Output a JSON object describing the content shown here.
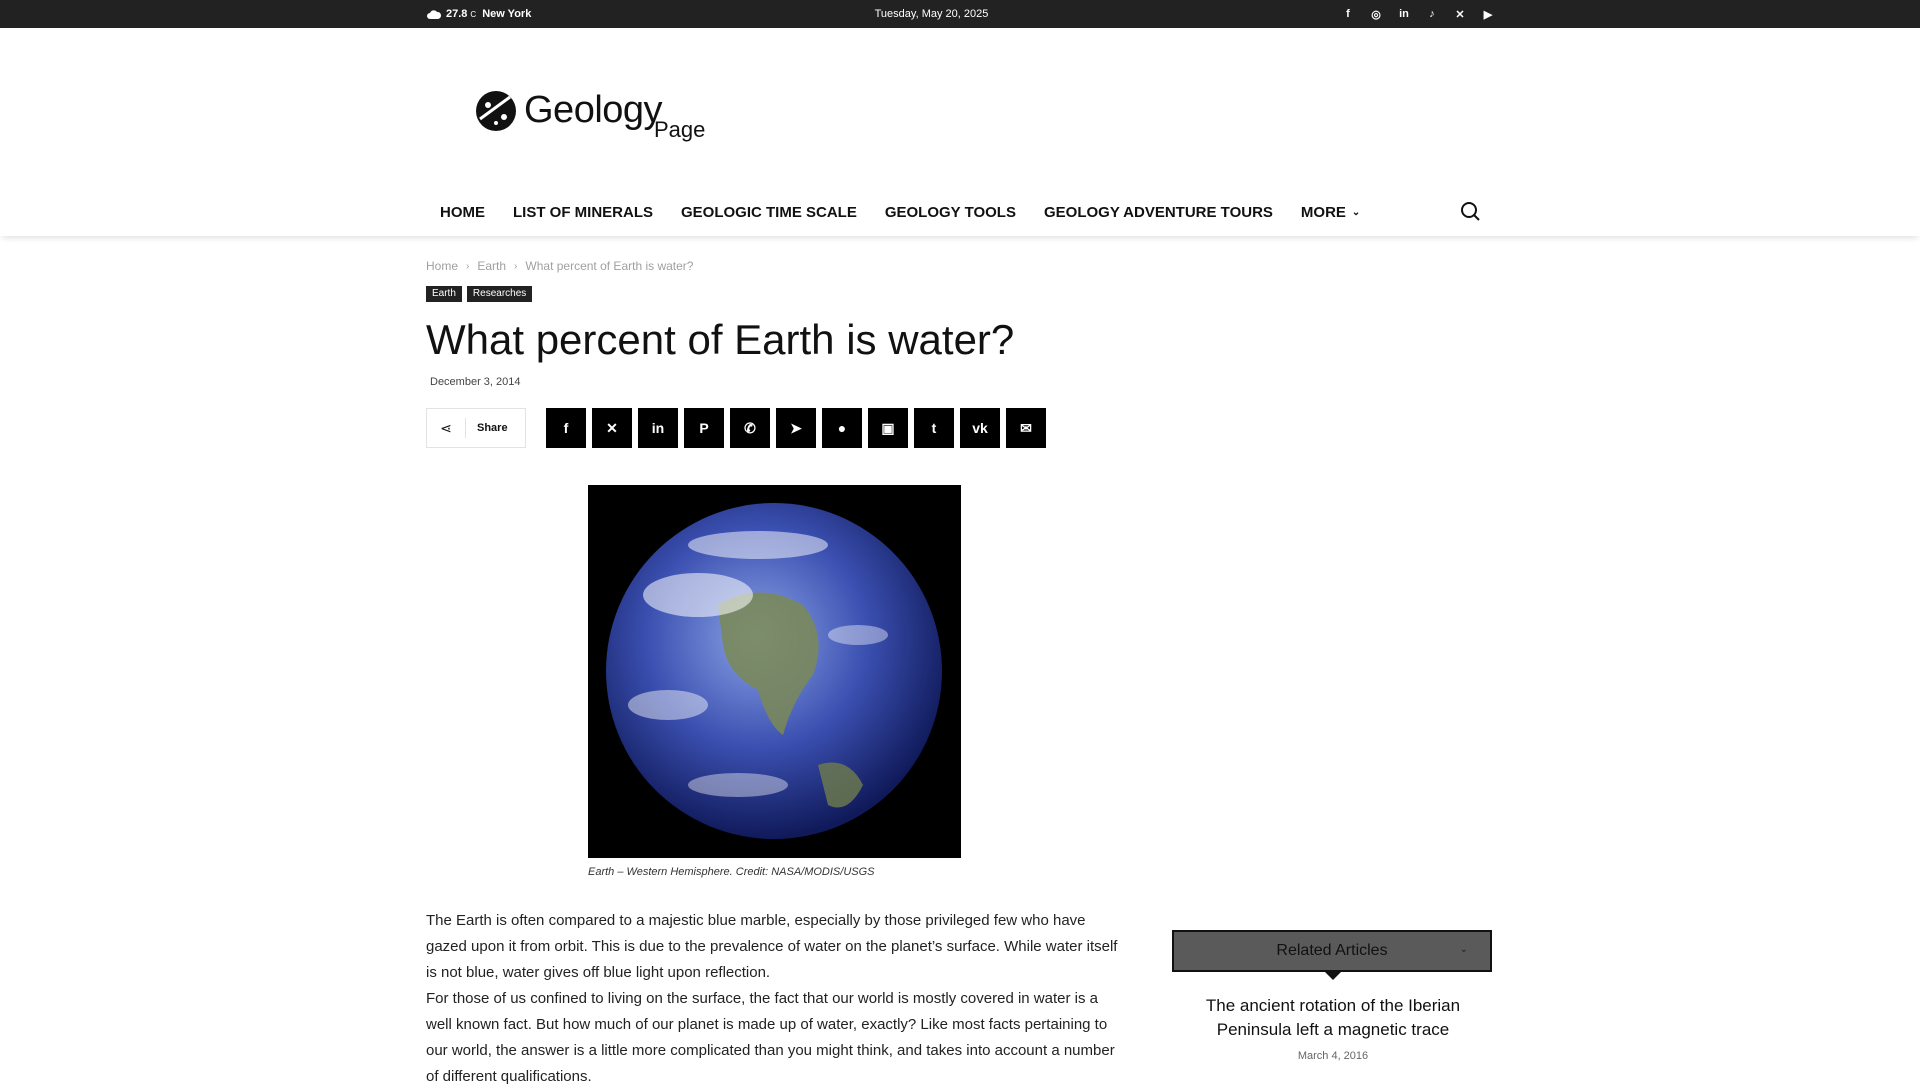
{
  "topbar": {
    "temperature": "27.8",
    "unit": "C",
    "city": "New York",
    "date": "Tuesday, May 20, 2025",
    "social_icons": [
      "facebook-icon",
      "instagram-icon",
      "linkedin-icon",
      "tiktok-icon",
      "x-icon",
      "youtube-icon"
    ]
  },
  "logo": {
    "word1": "Geology",
    "word2": "Page"
  },
  "nav": {
    "items": [
      "HOME",
      "LIST OF MINERALS",
      "GEOLOGIC TIME SCALE",
      "GEOLOGY TOOLS",
      "GEOLOGY ADVENTURE TOURS",
      "MORE"
    ]
  },
  "breadcrumb": [
    "Home",
    "Earth",
    "What percent of Earth is water?"
  ],
  "tags": [
    "Earth",
    "Researches"
  ],
  "article": {
    "title": "What percent of Earth is water?",
    "date": "December 3, 2014",
    "share_label": "Share",
    "share_buttons": [
      "facebook",
      "x",
      "linkedin",
      "pinterest",
      "whatsapp",
      "telegram",
      "reddit",
      "flipboard",
      "tumblr",
      "vk",
      "email"
    ],
    "caption": "Earth – Western Hemisphere. Credit: NASA/MODIS/USGS",
    "paragraphs": [
      "The Earth is often compared to a majestic blue marble, especially by those privileged few who have gazed upon it from orbit. This is due to the prevalence of water on the planet’s surface. While water itself is not blue, water gives off blue light upon reflection.",
      "For those of us confined to living on the surface, the fact that our world is mostly covered in water is a well known fact. But how much of our planet is made up of water, exactly? Like most facts pertaining to our world, the answer is a little more complicated than you might think, and takes into account a number of different qualifications."
    ]
  },
  "related": {
    "heading": "Related Articles",
    "article_title": "The ancient rotation of the Iberian Peninsula left a magnetic trace",
    "article_date": "March 4, 2016"
  }
}
